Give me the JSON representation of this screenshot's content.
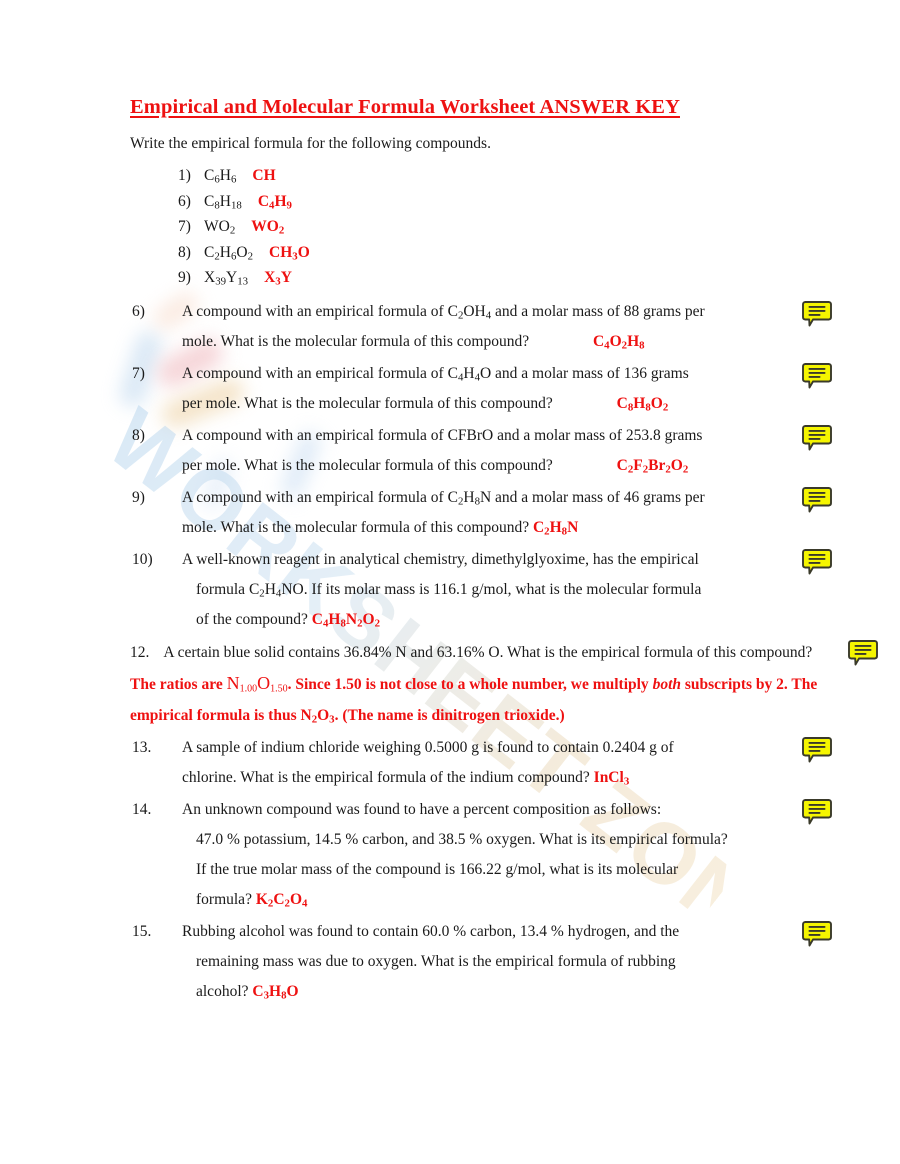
{
  "document": {
    "title": "Empirical and Molecular Formula Worksheet ANSWER KEY",
    "instruction": "Write the empirical formula for the following compounds.",
    "watermark": "WORKSHEET ZONE",
    "accent_red": "#ee1111",
    "body_color": "#1a1a1a",
    "icon_fill": "#f5f500",
    "icon_stroke": "#3a3a2a"
  },
  "formula_list": [
    {
      "num": "1)",
      "given_html": "C<sub>6</sub>H<sub>6</sub>",
      "answer_html": "CH"
    },
    {
      "num": "6)",
      "given_html": "C<sub>8</sub>H<sub>18</sub>",
      "answer_html": "C<sub>4</sub>H<sub>9</sub>"
    },
    {
      "num": "7)",
      "given_html": "WO<sub>2</sub>",
      "answer_html": "WO<sub>2</sub>"
    },
    {
      "num": "8)",
      "given_html": "C<sub>2</sub>H<sub>6</sub>O<sub>2</sub>",
      "answer_html": "CH<sub>3</sub>O"
    },
    {
      "num": "9)",
      "given_html": "X<sub>39</sub>Y<sub>13</sub>",
      "answer_html": "X<sub>3</sub>Y"
    }
  ],
  "problems": [
    {
      "num": "6)",
      "line1_html": "A compound with an empirical formula of C<sub>2</sub>OH<sub>4</sub> and a molar mass of 88 grams per",
      "line2_html": "mole.  What is the molecular formula of this compound?",
      "answer_html": "C<sub>4</sub>O<sub>2</sub>H<sub>8</sub>",
      "icon": "comment-icon"
    },
    {
      "num": "7)",
      "line1_html": "A compound with an empirical formula of C<sub>4</sub>H<sub>4</sub>O and a molar mass of 136 grams",
      "line2_html": "per mole.  What is the molecular formula of this compound?",
      "answer_html": "C<sub>8</sub>H<sub>8</sub>O<sub>2</sub>",
      "icon": "comment-icon"
    },
    {
      "num": "8)",
      "line1_html": "A compound with an empirical formula of CFBrO and a molar mass of 253.8 grams",
      "line2_html": "per mole.  What is the molecular formula of this compound?",
      "answer_html": "C<sub>2</sub>F<sub>2</sub>Br<sub>2</sub>O<sub>2</sub>",
      "icon": "comment-icon"
    },
    {
      "num": "9)",
      "line1_html": "A compound with an empirical formula of C<sub>2</sub>H<sub>8</sub>N and a molar mass of 46 grams per",
      "line2_html": "mole.  What is the molecular formula of this compound?",
      "answer_html": "C<sub>2</sub>H<sub>8</sub>N",
      "icon": "comment-icon"
    },
    {
      "num": "10)",
      "line1_html": "A well-known reagent in analytical chemistry, dimethylglyoxime, has the empirical",
      "line2_html": "formula C<sub>2</sub>H<sub>4</sub>NO.  If its molar mass is 116.1 g/mol, what is the molecular formula",
      "line3_html": "of the compound?",
      "answer_html": "C<sub>4</sub>H<sub>8</sub>N<sub>2</sub>O<sub>2</sub>",
      "icon": "comment-icon"
    },
    {
      "num": "13.",
      "line1_html": "A sample of indium chloride weighing 0.5000 g is found to contain 0.2404 g of",
      "line2_html": "chlorine.  What is the empirical formula of the indium compound?",
      "answer_html": "InCl<sub>3</sub>",
      "icon": "comment-icon"
    },
    {
      "num": "14.",
      "line1_html": "An unknown compound was found to have a percent composition as follows:",
      "line2_html": "47.0 % potassium, 14.5 % carbon, and 38.5 % oxygen.  What is its empirical formula?",
      "line3_html": "If the true molar mass of the compound is 166.22 g/mol, what is its molecular",
      "line4_html": "formula?",
      "answer_html": "K<sub>2</sub>C<sub>2</sub>O<sub>4</sub>",
      "icon": "comment-icon"
    },
    {
      "num": "15.",
      "line1_html": "Rubbing alcohol was found to contain 60.0 % carbon, 13.4 % hydrogen, and the",
      "line2_html": "remaining mass was due to oxygen.  What is the empirical formula of rubbing",
      "line3_html": "alcohol?",
      "answer_html": "C<sub>3</sub>H<sub>8</sub>O",
      "icon": "comment-icon"
    }
  ],
  "problem_12": {
    "num": "12.",
    "question_html": "A certain blue solid contains 36.84% N and 63.16% O.  What is the empirical formula of this",
    "question_cont_html": "compound?",
    "answer_lead_html": "The ratios are",
    "answer_math_html": "N<sub>1.00</sub>O<sub>1.50</sub>",
    "answer_rest_html": ".  Since 1.50 is not close to a whole number, we multiply <i>both</i> subscripts by 2.  The empirical formula is thus N<sub>2</sub>O<sub>3</sub>.  (The name is dinitrogen trioxide.)",
    "icon": "comment-icon"
  }
}
